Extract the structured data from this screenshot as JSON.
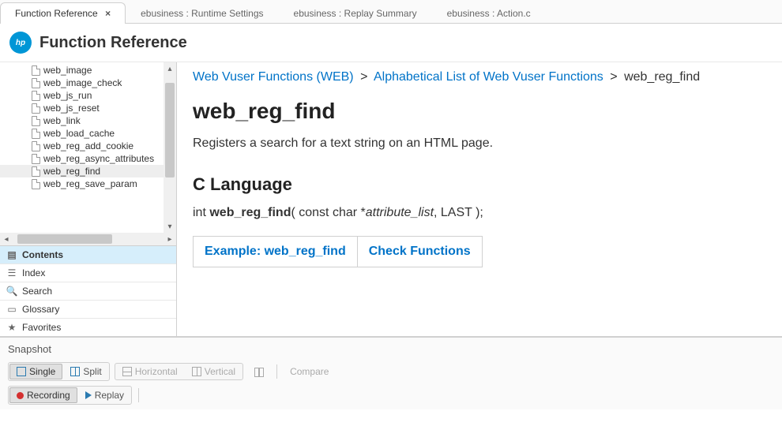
{
  "tabs": [
    {
      "label": "Function Reference",
      "active": true
    },
    {
      "label": "ebusiness : Runtime Settings",
      "active": false
    },
    {
      "label": "ebusiness : Replay Summary",
      "active": false
    },
    {
      "label": "ebusiness : Action.c",
      "active": false
    }
  ],
  "header": {
    "title": "Function Reference",
    "logo_text": "hp"
  },
  "tree": [
    {
      "label": "web_image"
    },
    {
      "label": "web_image_check"
    },
    {
      "label": "web_js_run"
    },
    {
      "label": "web_js_reset"
    },
    {
      "label": "web_link"
    },
    {
      "label": "web_load_cache"
    },
    {
      "label": "web_reg_add_cookie"
    },
    {
      "label": "web_reg_async_attributes"
    },
    {
      "label": "web_reg_find",
      "selected": true
    },
    {
      "label": "web_reg_save_param"
    }
  ],
  "nav": {
    "contents": "Contents",
    "index": "Index",
    "search": "Search",
    "glossary": "Glossary",
    "favorites": "Favorites"
  },
  "breadcrumb": {
    "a": "Web Vuser Functions (WEB)",
    "b": "Alphabetical List of Web Vuser Functions",
    "c": "web_reg_find"
  },
  "page": {
    "title": "web_reg_find",
    "desc": "Registers a search for a text string on an HTML page.",
    "section": "C Language",
    "sig_pre": "int ",
    "sig_fn": "web_reg_find",
    "sig_open": "( const char *",
    "sig_param": "attribute_list",
    "sig_close": ", LAST );",
    "link_example": "Example: web_reg_find",
    "link_check": "Check Functions"
  },
  "snapshot": {
    "label": "Snapshot",
    "single": "Single",
    "split": "Split",
    "horizontal": "Horizontal",
    "vertical": "Vertical",
    "compare": "Compare",
    "recording": "Recording",
    "replay": "Replay"
  }
}
